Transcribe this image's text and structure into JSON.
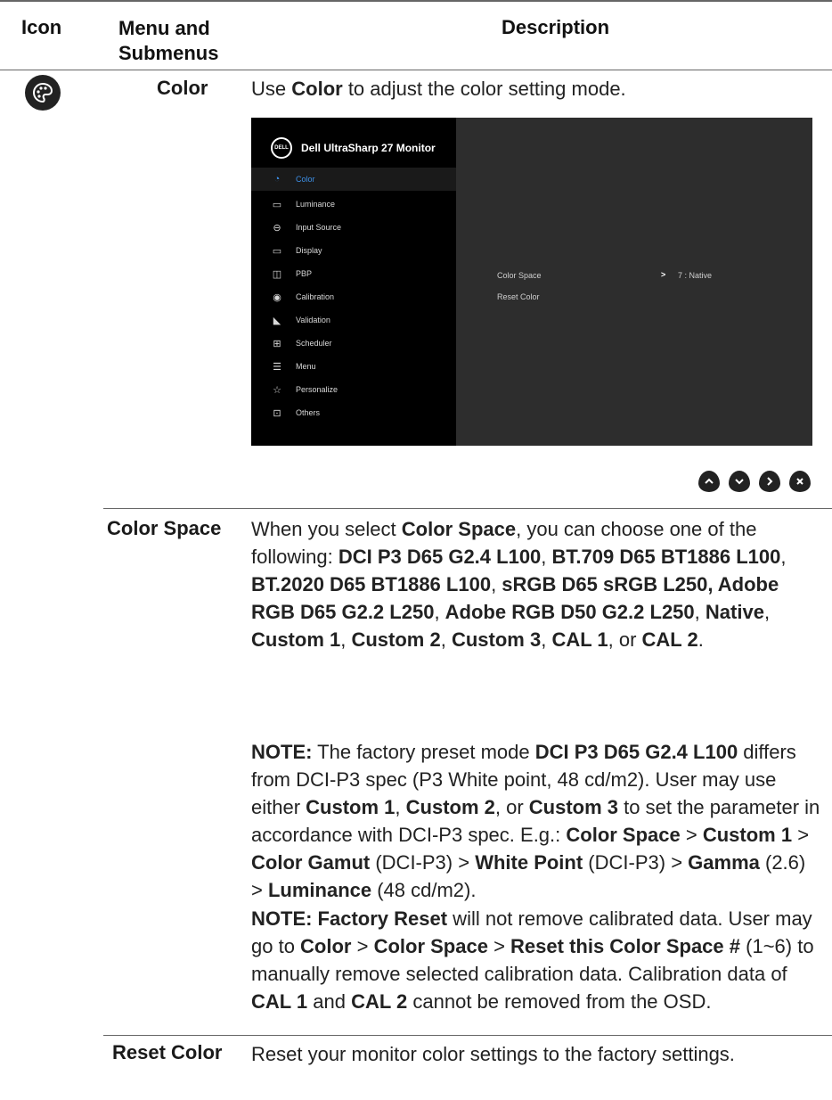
{
  "header": {
    "icon": "Icon",
    "menu_line1": "Menu and",
    "menu_line2": "Submenus",
    "description": "Description"
  },
  "rows": {
    "color": {
      "label": "Color",
      "icon": "palette-icon",
      "desc_pre": "Use ",
      "desc_bold": "Color",
      "desc_post": " to adjust the color setting mode."
    },
    "color_space": {
      "label": "Color Space"
    },
    "reset_color": {
      "label": "Reset Color",
      "desc": "Reset your monitor color settings to the factory settings."
    }
  },
  "osd": {
    "title": "Dell UltraSharp 27 Monitor",
    "logo": "DELL",
    "menu": [
      {
        "label": "Color",
        "icon": "palette-icon"
      },
      {
        "label": "Luminance",
        "icon": "luminance-icon"
      },
      {
        "label": "Input Source",
        "icon": "input-source-icon"
      },
      {
        "label": "Display",
        "icon": "display-icon"
      },
      {
        "label": "PBP",
        "icon": "pbp-icon"
      },
      {
        "label": "Calibration",
        "icon": "calibration-icon"
      },
      {
        "label": "Validation",
        "icon": "validation-icon"
      },
      {
        "label": "Scheduler",
        "icon": "scheduler-icon"
      },
      {
        "label": "Menu",
        "icon": "menu-icon"
      },
      {
        "label": "Personalize",
        "icon": "star-icon"
      },
      {
        "label": "Others",
        "icon": "others-icon"
      }
    ],
    "sub_color_space": "Color Space",
    "sub_arrow": ">",
    "sub_value": "7 : Native",
    "sub_reset": "Reset Color",
    "active_color": "#3d8fe6"
  },
  "nav_buttons": [
    "up-button",
    "down-button",
    "right-button",
    "close-button"
  ]
}
